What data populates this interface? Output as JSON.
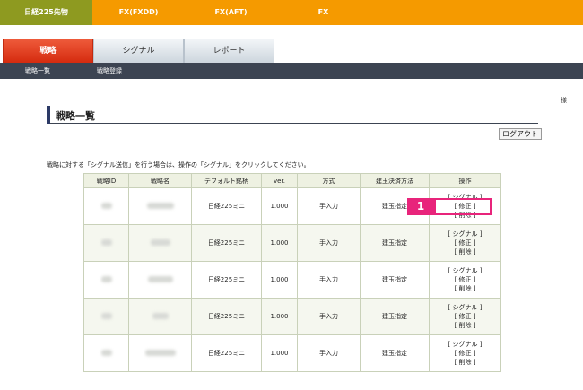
{
  "market_tabs": [
    {
      "label": "日経225先物",
      "active": true
    },
    {
      "label": "FX(FXDD)",
      "active": false
    },
    {
      "label": "FX(AFT)",
      "active": false
    },
    {
      "label": "FX",
      "active": false
    }
  ],
  "main_tabs": [
    {
      "label": "戦略",
      "active": true
    },
    {
      "label": "シグナル",
      "active": false
    },
    {
      "label": "レポート",
      "active": false
    }
  ],
  "sub_nav": [
    "戦略一覧",
    "戦略登録"
  ],
  "user_suffix": "様",
  "page_title": "戦略一覧",
  "logout_label": "ログアウト",
  "notice": "戦略に対する「シグナル送信」を行う場合は、操作の「シグナル」をクリックしてください。",
  "table": {
    "headers": [
      "戦略ID",
      "戦略名",
      "デフォルト銘柄",
      "ver.",
      "方式",
      "建玉決済方法",
      "操作"
    ],
    "rows": [
      {
        "symbol": "日経225ミニ",
        "ver": "1.000",
        "method": "手入力",
        "settlement": "建玉指定"
      },
      {
        "symbol": "日経225ミニ",
        "ver": "1.000",
        "method": "手入力",
        "settlement": "建玉指定"
      },
      {
        "symbol": "日経225ミニ",
        "ver": "1.000",
        "method": "手入力",
        "settlement": "建玉指定"
      },
      {
        "symbol": "日経225ミニ",
        "ver": "1.000",
        "method": "手入力",
        "settlement": "建玉指定"
      },
      {
        "symbol": "日経225ミニ",
        "ver": "1.000",
        "method": "手入力",
        "settlement": "建玉指定"
      }
    ],
    "operations": {
      "signal": "[ シグナル ]",
      "edit": "[ 修正 ]",
      "delete": "[ 削除 ]"
    }
  },
  "callout": {
    "number": "1"
  },
  "colors": {
    "market_bar": "#f59a00",
    "market_active": "#8e9a20",
    "tab_active": "#d52b0f",
    "sub_nav": "#3c4452",
    "callout": "#e8247b"
  }
}
